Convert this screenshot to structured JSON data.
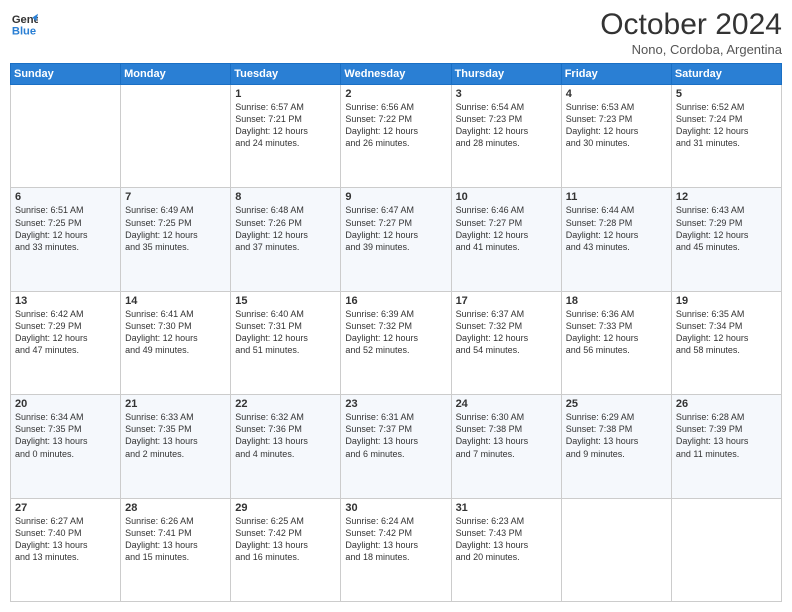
{
  "logo": {
    "line1": "General",
    "line2": "Blue"
  },
  "title": "October 2024",
  "location": "Nono, Cordoba, Argentina",
  "days_header": [
    "Sunday",
    "Monday",
    "Tuesday",
    "Wednesday",
    "Thursday",
    "Friday",
    "Saturday"
  ],
  "weeks": [
    [
      {
        "day": "",
        "content": ""
      },
      {
        "day": "",
        "content": ""
      },
      {
        "day": "1",
        "content": "Sunrise: 6:57 AM\nSunset: 7:21 PM\nDaylight: 12 hours\nand 24 minutes."
      },
      {
        "day": "2",
        "content": "Sunrise: 6:56 AM\nSunset: 7:22 PM\nDaylight: 12 hours\nand 26 minutes."
      },
      {
        "day": "3",
        "content": "Sunrise: 6:54 AM\nSunset: 7:23 PM\nDaylight: 12 hours\nand 28 minutes."
      },
      {
        "day": "4",
        "content": "Sunrise: 6:53 AM\nSunset: 7:23 PM\nDaylight: 12 hours\nand 30 minutes."
      },
      {
        "day": "5",
        "content": "Sunrise: 6:52 AM\nSunset: 7:24 PM\nDaylight: 12 hours\nand 31 minutes."
      }
    ],
    [
      {
        "day": "6",
        "content": "Sunrise: 6:51 AM\nSunset: 7:25 PM\nDaylight: 12 hours\nand 33 minutes."
      },
      {
        "day": "7",
        "content": "Sunrise: 6:49 AM\nSunset: 7:25 PM\nDaylight: 12 hours\nand 35 minutes."
      },
      {
        "day": "8",
        "content": "Sunrise: 6:48 AM\nSunset: 7:26 PM\nDaylight: 12 hours\nand 37 minutes."
      },
      {
        "day": "9",
        "content": "Sunrise: 6:47 AM\nSunset: 7:27 PM\nDaylight: 12 hours\nand 39 minutes."
      },
      {
        "day": "10",
        "content": "Sunrise: 6:46 AM\nSunset: 7:27 PM\nDaylight: 12 hours\nand 41 minutes."
      },
      {
        "day": "11",
        "content": "Sunrise: 6:44 AM\nSunset: 7:28 PM\nDaylight: 12 hours\nand 43 minutes."
      },
      {
        "day": "12",
        "content": "Sunrise: 6:43 AM\nSunset: 7:29 PM\nDaylight: 12 hours\nand 45 minutes."
      }
    ],
    [
      {
        "day": "13",
        "content": "Sunrise: 6:42 AM\nSunset: 7:29 PM\nDaylight: 12 hours\nand 47 minutes."
      },
      {
        "day": "14",
        "content": "Sunrise: 6:41 AM\nSunset: 7:30 PM\nDaylight: 12 hours\nand 49 minutes."
      },
      {
        "day": "15",
        "content": "Sunrise: 6:40 AM\nSunset: 7:31 PM\nDaylight: 12 hours\nand 51 minutes."
      },
      {
        "day": "16",
        "content": "Sunrise: 6:39 AM\nSunset: 7:32 PM\nDaylight: 12 hours\nand 52 minutes."
      },
      {
        "day": "17",
        "content": "Sunrise: 6:37 AM\nSunset: 7:32 PM\nDaylight: 12 hours\nand 54 minutes."
      },
      {
        "day": "18",
        "content": "Sunrise: 6:36 AM\nSunset: 7:33 PM\nDaylight: 12 hours\nand 56 minutes."
      },
      {
        "day": "19",
        "content": "Sunrise: 6:35 AM\nSunset: 7:34 PM\nDaylight: 12 hours\nand 58 minutes."
      }
    ],
    [
      {
        "day": "20",
        "content": "Sunrise: 6:34 AM\nSunset: 7:35 PM\nDaylight: 13 hours\nand 0 minutes."
      },
      {
        "day": "21",
        "content": "Sunrise: 6:33 AM\nSunset: 7:35 PM\nDaylight: 13 hours\nand 2 minutes."
      },
      {
        "day": "22",
        "content": "Sunrise: 6:32 AM\nSunset: 7:36 PM\nDaylight: 13 hours\nand 4 minutes."
      },
      {
        "day": "23",
        "content": "Sunrise: 6:31 AM\nSunset: 7:37 PM\nDaylight: 13 hours\nand 6 minutes."
      },
      {
        "day": "24",
        "content": "Sunrise: 6:30 AM\nSunset: 7:38 PM\nDaylight: 13 hours\nand 7 minutes."
      },
      {
        "day": "25",
        "content": "Sunrise: 6:29 AM\nSunset: 7:38 PM\nDaylight: 13 hours\nand 9 minutes."
      },
      {
        "day": "26",
        "content": "Sunrise: 6:28 AM\nSunset: 7:39 PM\nDaylight: 13 hours\nand 11 minutes."
      }
    ],
    [
      {
        "day": "27",
        "content": "Sunrise: 6:27 AM\nSunset: 7:40 PM\nDaylight: 13 hours\nand 13 minutes."
      },
      {
        "day": "28",
        "content": "Sunrise: 6:26 AM\nSunset: 7:41 PM\nDaylight: 13 hours\nand 15 minutes."
      },
      {
        "day": "29",
        "content": "Sunrise: 6:25 AM\nSunset: 7:42 PM\nDaylight: 13 hours\nand 16 minutes."
      },
      {
        "day": "30",
        "content": "Sunrise: 6:24 AM\nSunset: 7:42 PM\nDaylight: 13 hours\nand 18 minutes."
      },
      {
        "day": "31",
        "content": "Sunrise: 6:23 AM\nSunset: 7:43 PM\nDaylight: 13 hours\nand 20 minutes."
      },
      {
        "day": "",
        "content": ""
      },
      {
        "day": "",
        "content": ""
      }
    ]
  ]
}
